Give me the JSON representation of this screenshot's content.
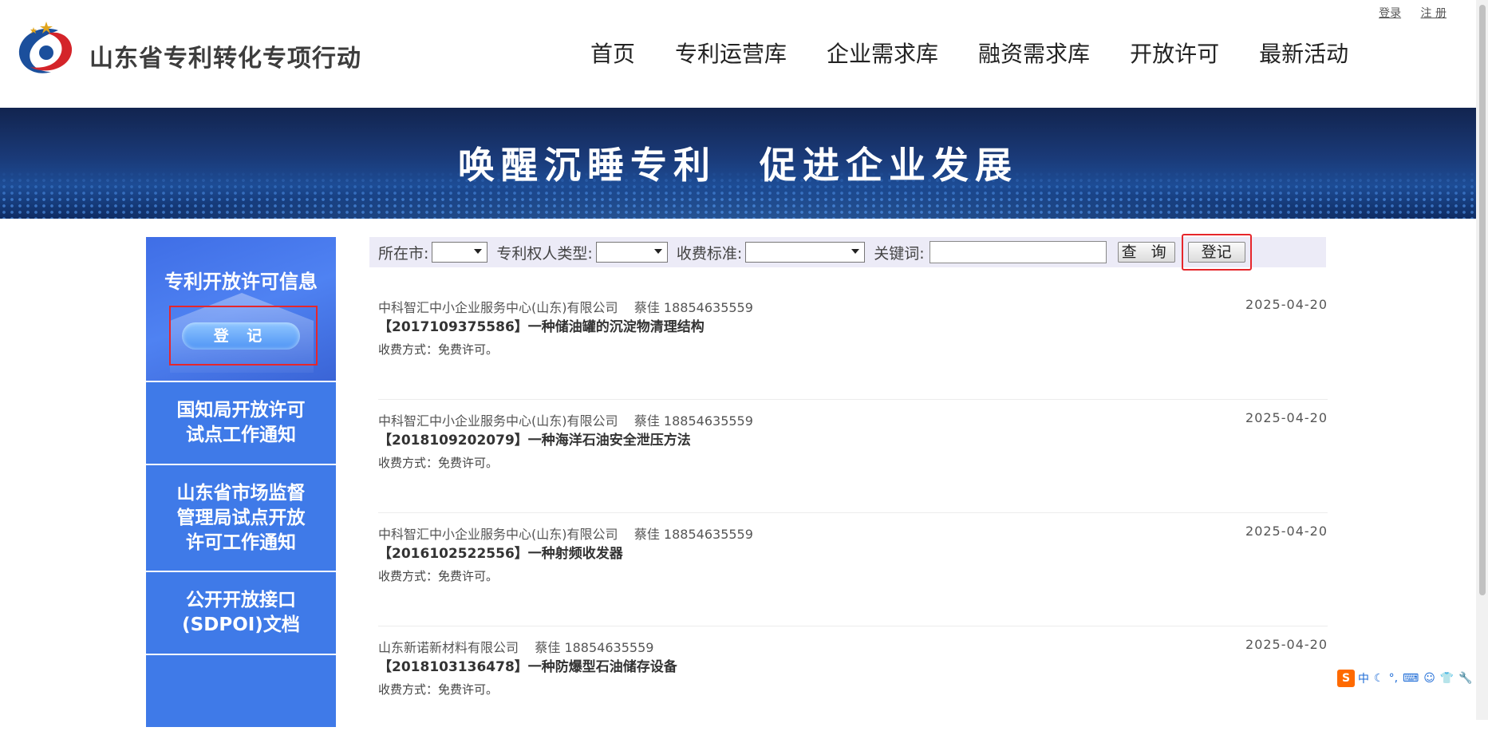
{
  "top_links": {
    "login": "登录",
    "register": "注 册"
  },
  "site": {
    "title": "山东省专利转化专项行动"
  },
  "nav": [
    "首页",
    "专利运营库",
    "企业需求库",
    "融资需求库",
    "开放许可",
    "最新活动"
  ],
  "banner": {
    "text": "唤醒沉睡专利　促进企业发展"
  },
  "sidebar": {
    "top_title": "专利开放许可信息",
    "register_button": "登 记",
    "items": [
      {
        "label": "国知局开放许可\n试点工作通知"
      },
      {
        "label": "山东省市场监督\n管理局试点开放\n许可工作通知"
      },
      {
        "label": "公开开放接口\n(SDPOI)文档"
      }
    ]
  },
  "filter": {
    "city_label": "所在市:",
    "owner_type_label": "专利权人类型:",
    "fee_label": "收费标准:",
    "keyword_label": "关键词:",
    "keyword_value": "",
    "search_button": "查 询",
    "register_button": "登记"
  },
  "listings": [
    {
      "company": "中科智汇中小企业服务中心(山东)有限公司",
      "contact": "蔡佳 18854635559",
      "date": "2025-04-20",
      "title": "【2017109375586】一种储油罐的沉淀物清理结构",
      "fee": "收费方式：免费许可。"
    },
    {
      "company": "中科智汇中小企业服务中心(山东)有限公司",
      "contact": "蔡佳 18854635559",
      "date": "2025-04-20",
      "title": "【2018109202079】一种海洋石油安全泄压方法",
      "fee": "收费方式：免费许可。"
    },
    {
      "company": "中科智汇中小企业服务中心(山东)有限公司",
      "contact": "蔡佳 18854635559",
      "date": "2025-04-20",
      "title": "【2016102522556】一种射频收发器",
      "fee": "收费方式：免费许可。"
    },
    {
      "company": "山东新诺新材料有限公司",
      "contact": "蔡佳 18854635559",
      "date": "2025-04-20",
      "title": "【2018103136478】一种防爆型石油储存设备",
      "fee": "收费方式：免费许可。"
    }
  ],
  "ime": {
    "logo": "S",
    "mode": "中"
  },
  "colors": {
    "sidebar_blue": "#3f7ae8",
    "banner_dark": "#12244f",
    "highlight_red": "#e6262b",
    "filter_bg": "#ecebf7"
  }
}
